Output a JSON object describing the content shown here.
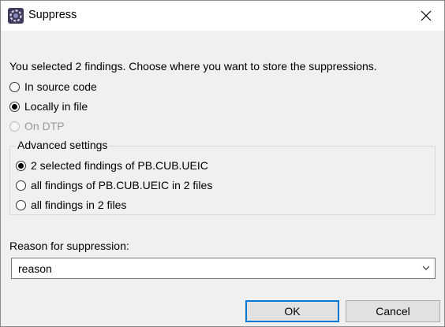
{
  "window": {
    "title": "Suppress",
    "app_icon": "gear-icon",
    "close_icon": "close-icon"
  },
  "prompt": "You selected 2 findings. Choose where you want to store the suppressions.",
  "storage_options": [
    {
      "label": "In source code",
      "checked": false,
      "disabled": false
    },
    {
      "label": "Locally in file",
      "checked": true,
      "disabled": false
    },
    {
      "label": "On DTP",
      "checked": false,
      "disabled": true
    }
  ],
  "advanced": {
    "legend": "Advanced settings",
    "options": [
      {
        "label": "2 selected findings of PB.CUB.UEIC",
        "checked": true
      },
      {
        "label": "all findings of PB.CUB.UEIC in 2 files",
        "checked": false
      },
      {
        "label": "all findings in 2 files",
        "checked": false
      }
    ]
  },
  "reason": {
    "label": "Reason for suppression:",
    "value": "reason",
    "arrow_icon": "chevron-down-icon"
  },
  "buttons": {
    "ok": "OK",
    "cancel": "Cancel"
  },
  "colors": {
    "dialog_bg": "#f0f0f0",
    "titlebar_bg": "#ffffff",
    "default_button_border": "#0078d7",
    "disabled_text": "#9a9a9a"
  }
}
